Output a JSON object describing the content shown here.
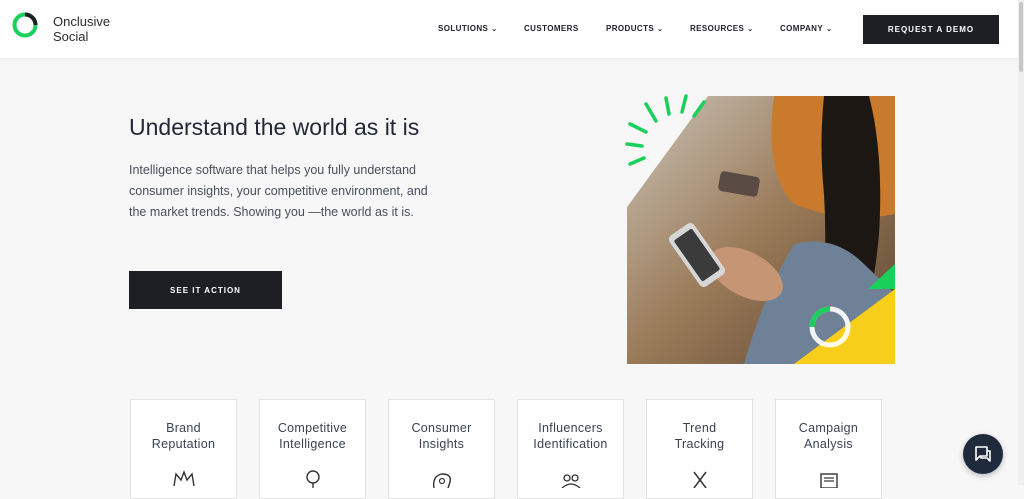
{
  "brand": {
    "line1": "Onclusive",
    "line2": "Social",
    "ring_color": "#18d05a",
    "dark_color": "#1d1f25"
  },
  "nav": {
    "items": [
      {
        "label": "SOLUTIONS",
        "has_dropdown": true
      },
      {
        "label": "CUSTOMERS",
        "has_dropdown": false
      },
      {
        "label": "PRODUCTS",
        "has_dropdown": true
      },
      {
        "label": "RESOURCES",
        "has_dropdown": true
      },
      {
        "label": "COMPANY",
        "has_dropdown": true
      }
    ],
    "chevron": "⌄",
    "cta_label": "REQUEST A DEMO"
  },
  "hero": {
    "title": "Understand the world as it is",
    "description": "Intelligence software that helps you fully understand consumer insights, your competitive environment, and the market trends. Showing you —the world as it is.",
    "button_label": "SEE IT ACTION",
    "accent_green": "#18d05a",
    "accent_yellow": "#f7cf1a"
  },
  "cards": [
    {
      "label": "Brand\nReputation",
      "icon": "crown-icon"
    },
    {
      "label": "Competitive\nIntelligence",
      "icon": "lightbulb-icon"
    },
    {
      "label": "Consumer\nInsights",
      "icon": "head-gear-icon"
    },
    {
      "label": "Influencers\nIdentification",
      "icon": "people-icon"
    },
    {
      "label": "Trend\nTracking",
      "icon": "tools-icon"
    },
    {
      "label": "Campaign\nAnalysis",
      "icon": "newspaper-icon"
    }
  ],
  "chat": {
    "icon": "chat-icon"
  }
}
